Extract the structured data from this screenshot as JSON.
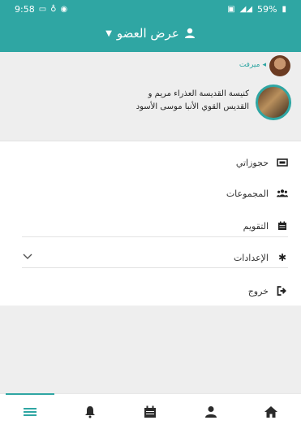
{
  "status_bar": {
    "time": "9:58",
    "battery": "59%"
  },
  "app_bar": {
    "title": "عرض العضو",
    "title_icon": "user-icon",
    "dropdown_icon": "caret-down-icon"
  },
  "profile": {
    "user_name": "ميرفت",
    "church_name_line1": "كنيسة القديسة العذراء مريم و",
    "church_name_line2": "القديس القوي الأنبا موسى الأسود"
  },
  "menu": {
    "reservations": {
      "label": "حجوزاتي",
      "icon": "ticket-icon"
    },
    "groups": {
      "label": "المجموعات",
      "icon": "users-icon"
    },
    "calendar": {
      "label": "التقويم",
      "icon": "calendar-icon"
    },
    "settings": {
      "label": "الإعدادات",
      "icon": "gear-icon"
    },
    "logout": {
      "label": "خروج",
      "icon": "logout-icon"
    }
  },
  "bottom_nav": [
    "menu-icon",
    "bell-icon",
    "calendar-icon",
    "user-icon",
    "home-icon"
  ],
  "colors": {
    "accent": "#2fa6a3"
  }
}
